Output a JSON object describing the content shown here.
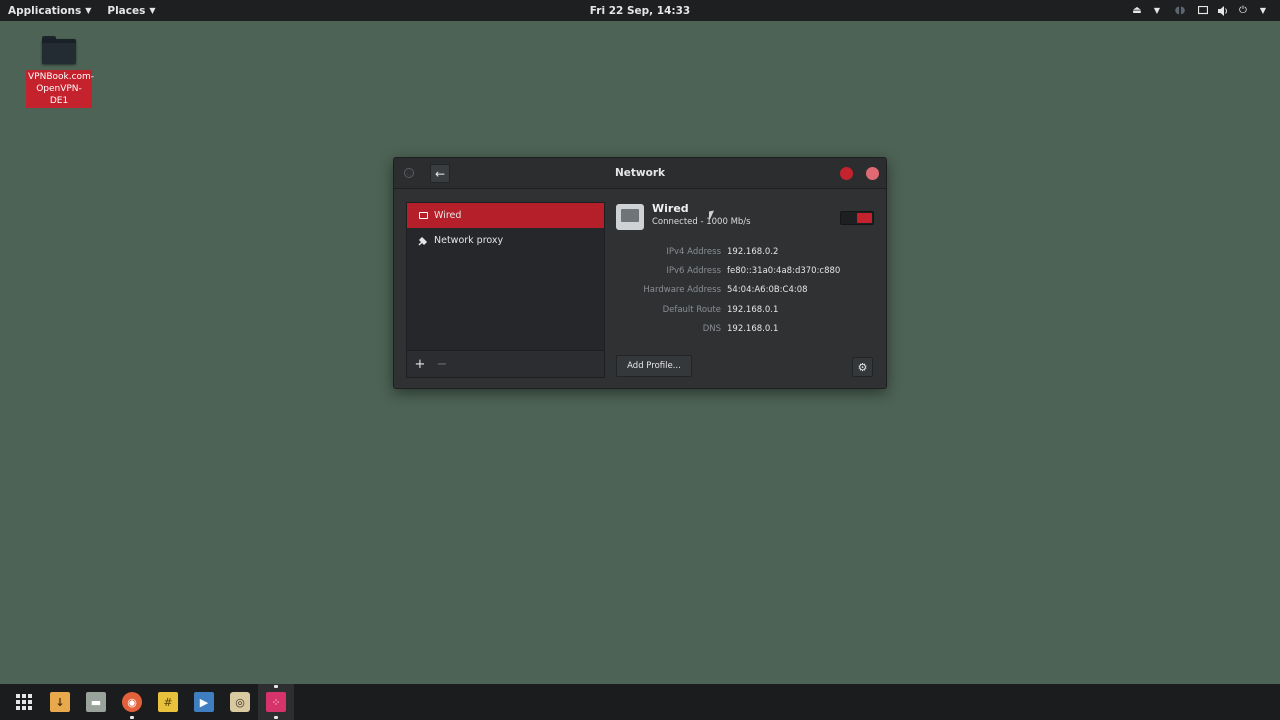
{
  "topbar": {
    "applications_label": "Applications",
    "places_label": "Places",
    "clock": "Fri 22 Sep, 14:33"
  },
  "desktop": {
    "icon_label": "VPNBook.com-OpenVPN-DE1"
  },
  "window": {
    "title": "Network",
    "sidebar": {
      "items": [
        {
          "label": "Wired",
          "icon": "wired-icon",
          "active": true
        },
        {
          "label": "Network proxy",
          "icon": "proxy-icon",
          "active": false
        }
      ],
      "add_label": "+",
      "remove_label": "−"
    },
    "details": {
      "title": "Wired",
      "status": "Connected - 1000 Mb/s",
      "rows": [
        {
          "key": "IPv4 Address",
          "value": "192.168.0.2"
        },
        {
          "key": "IPv6 Address",
          "value": "fe80::31a0:4a8:d370:c880"
        },
        {
          "key": "Hardware Address",
          "value": "54:04:A6:0B:C4:08"
        },
        {
          "key": "Default Route",
          "value": "192.168.0.1"
        },
        {
          "key": "DNS",
          "value": "192.168.0.1"
        }
      ],
      "add_profile_label": "Add Profile..."
    }
  },
  "colors": {
    "accent": "#c4222d",
    "desktop_bg": "#4d6355"
  }
}
